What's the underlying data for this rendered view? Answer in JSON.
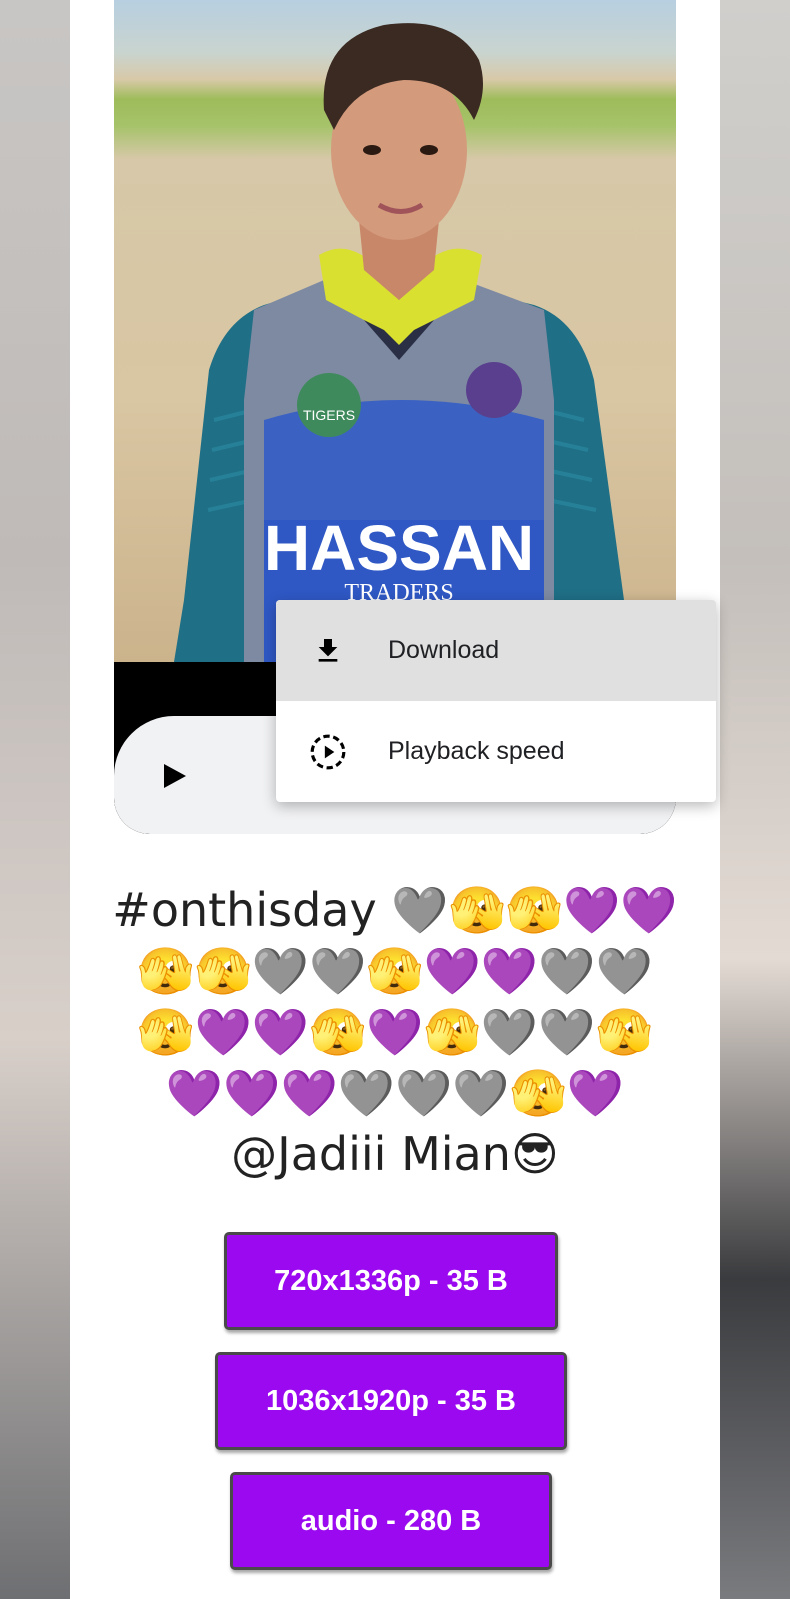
{
  "menu": {
    "items": [
      {
        "label": "Download",
        "icon": "download-icon"
      },
      {
        "label": "Playback speed",
        "icon": "playback-speed-icon"
      }
    ]
  },
  "photo": {
    "shirt_text": "HASSAN",
    "shirt_subtext": "TRADERS",
    "logo_text": "TIGERS"
  },
  "caption": "#onthisday 🩶🫣🫣💜💜🫣🫣🩶🩶🫣💜💜🩶🩶🫣💜💜🫣💜🫣🩶🩶🫣💜💜💜🩶🩶🩶🫣💜@Jadiii Mian😎",
  "downloads": [
    {
      "label": "720x1336p - 35 B"
    },
    {
      "label": "1036x1920p - 35 B"
    },
    {
      "label": "audio - 280 B"
    }
  ],
  "colors": {
    "button_bg": "#9a09ef",
    "button_border": "#4a4a4a",
    "menu_highlight": "#e0e0e0"
  }
}
